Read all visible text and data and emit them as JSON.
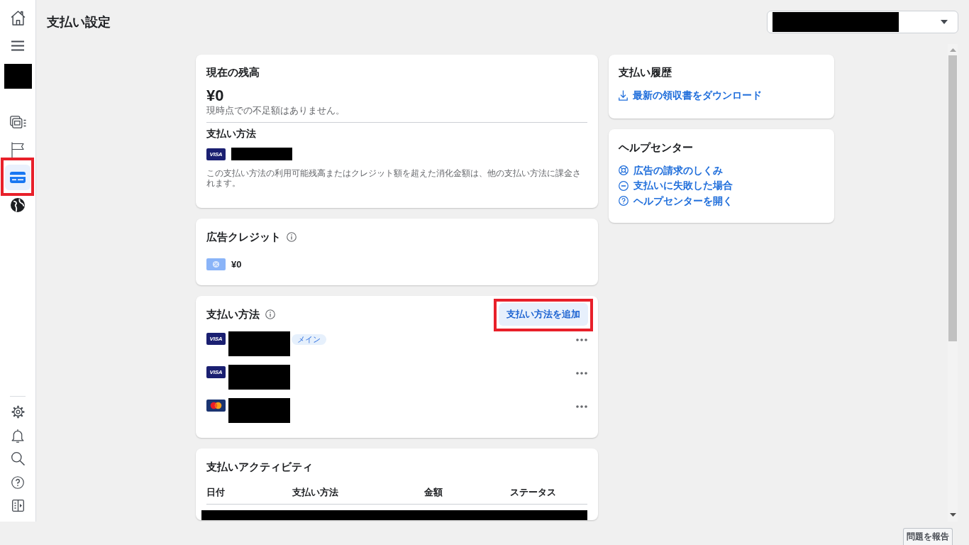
{
  "sidebar": {
    "top_items": [
      {
        "kind": "home",
        "selected": false,
        "highlighted": false
      },
      {
        "kind": "menu",
        "selected": false,
        "highlighted": false
      },
      {
        "kind": "avatar",
        "redacted": true
      },
      {
        "kind": "pages",
        "selected": false,
        "highlighted": false
      },
      {
        "kind": "flag",
        "selected": false,
        "highlighted": false
      },
      {
        "kind": "billing",
        "selected": true,
        "highlighted": true
      },
      {
        "kind": "globe",
        "selected": false,
        "highlighted": false
      }
    ],
    "bottom_items": [
      {
        "kind": "settings",
        "selected": false,
        "highlighted": false
      },
      {
        "kind": "bell",
        "selected": false,
        "highlighted": false
      },
      {
        "kind": "search",
        "selected": false,
        "highlighted": false
      },
      {
        "kind": "help",
        "selected": false,
        "highlighted": false
      },
      {
        "kind": "panel",
        "selected": false,
        "highlighted": false
      }
    ]
  },
  "header": {
    "title": "支払い設定",
    "account_selector": {
      "redacted": true
    }
  },
  "balance": {
    "title": "現在の残高",
    "amount": "¥0",
    "note": "現時点での不足額はありません。",
    "method_title": "支払い方法",
    "method": {
      "kind": "visa",
      "logo": "VISA",
      "redacted": true
    },
    "description": "この支払い方法の利用可能残高またはクレジット額を超えた消化金額は、他の支払い方法に課金されます。"
  },
  "ad_credit": {
    "title": "広告クレジット",
    "amount": "¥0"
  },
  "payment_methods": {
    "title": "支払い方法",
    "add_button": {
      "label": "支払い方法を追加",
      "highlighted": true
    },
    "items": [
      {
        "kind": "visa",
        "logo": "VISA",
        "redacted": true,
        "badge": "メイン"
      },
      {
        "kind": "visa",
        "logo": "VISA",
        "redacted": true
      },
      {
        "kind": "mastercard",
        "redacted": true
      }
    ]
  },
  "activity": {
    "title": "支払いアクティビティ",
    "columns": [
      "日付",
      "支払い方法",
      "金額",
      "ステータス"
    ],
    "rows": [
      {
        "redacted": true
      }
    ]
  },
  "payment_history": {
    "title": "支払い履歴",
    "links": [
      {
        "kind": "download",
        "label": "最新の領収書をダウンロード"
      }
    ]
  },
  "help_center": {
    "title": "ヘルプセンター",
    "links": [
      {
        "kind": "guide",
        "label": "広告の請求のしくみ"
      },
      {
        "kind": "failed",
        "label": "支払いに失敗した場合"
      },
      {
        "kind": "help",
        "label": "ヘルプセンターを開く"
      }
    ]
  },
  "footer": {
    "report_button": "問題を報告"
  }
}
